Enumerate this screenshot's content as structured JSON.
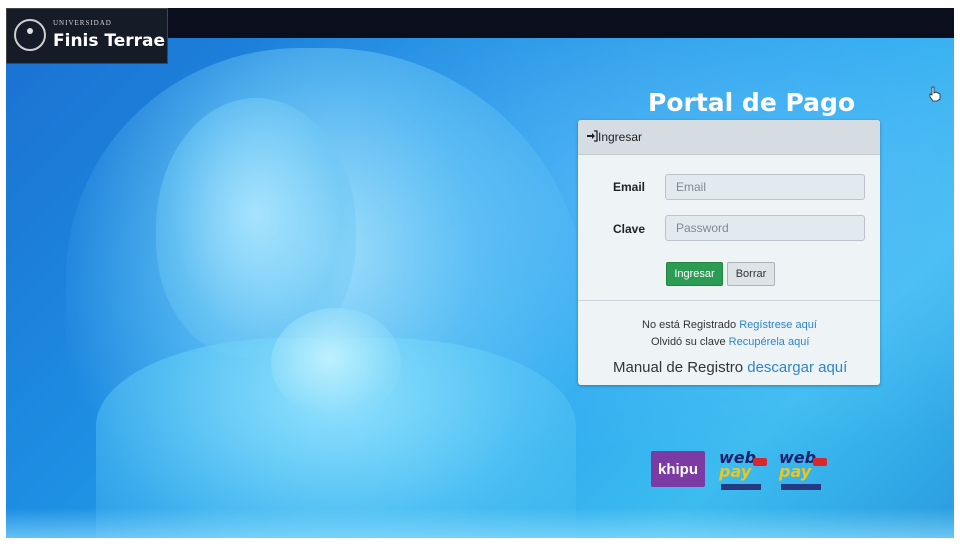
{
  "header": {
    "university_small": "UNIVERSIDAD",
    "university_name": "Finis Terrae"
  },
  "portal": {
    "title": "Portal de Pago"
  },
  "login": {
    "header_label": "Ingresar",
    "email_label": "Email",
    "email_placeholder": "Email",
    "password_label": "Clave",
    "password_placeholder": "Password",
    "submit_label": "Ingresar",
    "clear_label": "Borrar"
  },
  "footer_links": {
    "not_registered_text": "No está Registrado",
    "register_link": "Regístrese aquí",
    "forgot_text": "Olvidó su clave",
    "recover_link": "Recupérela aquí",
    "manual_text": "Manual de Registro",
    "manual_link": "descargar aquí"
  },
  "payment_logos": {
    "khipu": "khipu",
    "webpay_1_top": "web",
    "webpay_1_bottom": "pay",
    "webpay_2_top": "web",
    "webpay_2_bottom": "pay"
  },
  "colors": {
    "accent_blue": "#2c86c9",
    "button_green": "#2c9b54",
    "khipu_purple": "#7c3aa4"
  }
}
